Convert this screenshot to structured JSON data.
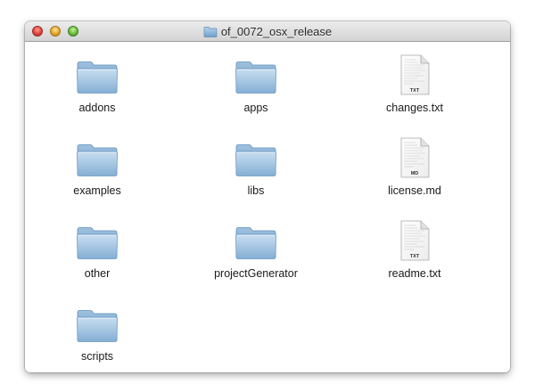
{
  "window": {
    "title": "of_0072_osx_release",
    "title_icon": "folder-icon",
    "buttons": [
      "close",
      "minimize",
      "zoom"
    ]
  },
  "items": [
    {
      "label": "addons",
      "kind": "folder",
      "icon": "folder-icon"
    },
    {
      "label": "apps",
      "kind": "folder",
      "icon": "folder-icon"
    },
    {
      "label": "changes.txt",
      "kind": "document",
      "icon": "text-file-icon",
      "badge": "TXT"
    },
    {
      "label": "examples",
      "kind": "folder",
      "icon": "folder-icon"
    },
    {
      "label": "libs",
      "kind": "folder",
      "icon": "folder-icon"
    },
    {
      "label": "license.md",
      "kind": "document",
      "icon": "markdown-file-icon",
      "badge": "MD"
    },
    {
      "label": "other",
      "kind": "folder",
      "icon": "folder-icon"
    },
    {
      "label": "projectGenerator",
      "kind": "folder",
      "icon": "folder-icon"
    },
    {
      "label": "readme.txt",
      "kind": "document",
      "icon": "text-file-icon",
      "badge": "TXT"
    },
    {
      "label": "scripts",
      "kind": "folder",
      "icon": "folder-icon"
    }
  ],
  "colors": {
    "folder_light": "#b9d4ea",
    "folder_dark": "#7fa9cd",
    "label_text": "#1a1a1a"
  }
}
